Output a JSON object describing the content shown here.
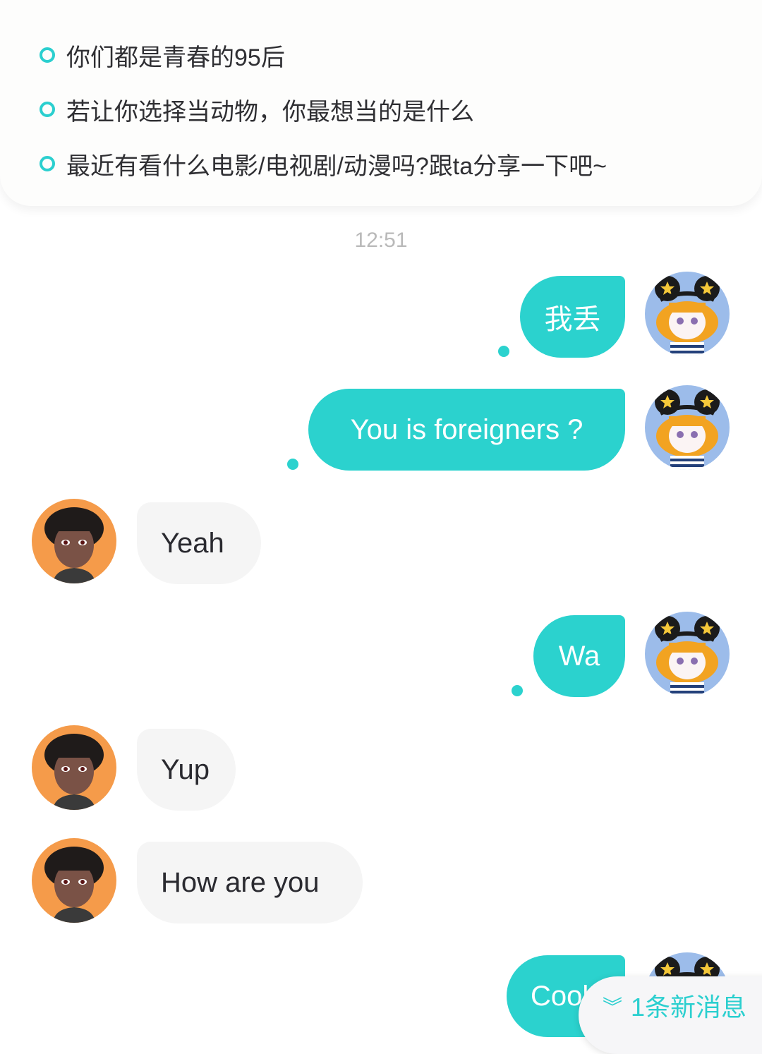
{
  "topics": [
    {
      "text": "你们都是青春的95后"
    },
    {
      "text": "若让你选择当动物，你最想当的是什么"
    },
    {
      "text": "最近有看什么电影/电视剧/动漫吗?跟ta分享一下吧~"
    }
  ],
  "timestamp": "12:51",
  "messages": [
    {
      "side": "out",
      "text": "我丢"
    },
    {
      "side": "out",
      "text": "You is foreigners ?"
    },
    {
      "side": "in",
      "text": "Yeah"
    },
    {
      "side": "out",
      "text": "Wa"
    },
    {
      "side": "in",
      "text": "Yup"
    },
    {
      "side": "in",
      "text": "How are you"
    },
    {
      "side": "out",
      "text": "Cool"
    }
  ],
  "new_message_banner": {
    "icon": "double-chevron-down-icon",
    "label": "1条新消息"
  },
  "colors": {
    "accent": "#2bd2ce",
    "incoming_bubble": "#f5f5f5",
    "timestamp": "#b9b9b9"
  }
}
